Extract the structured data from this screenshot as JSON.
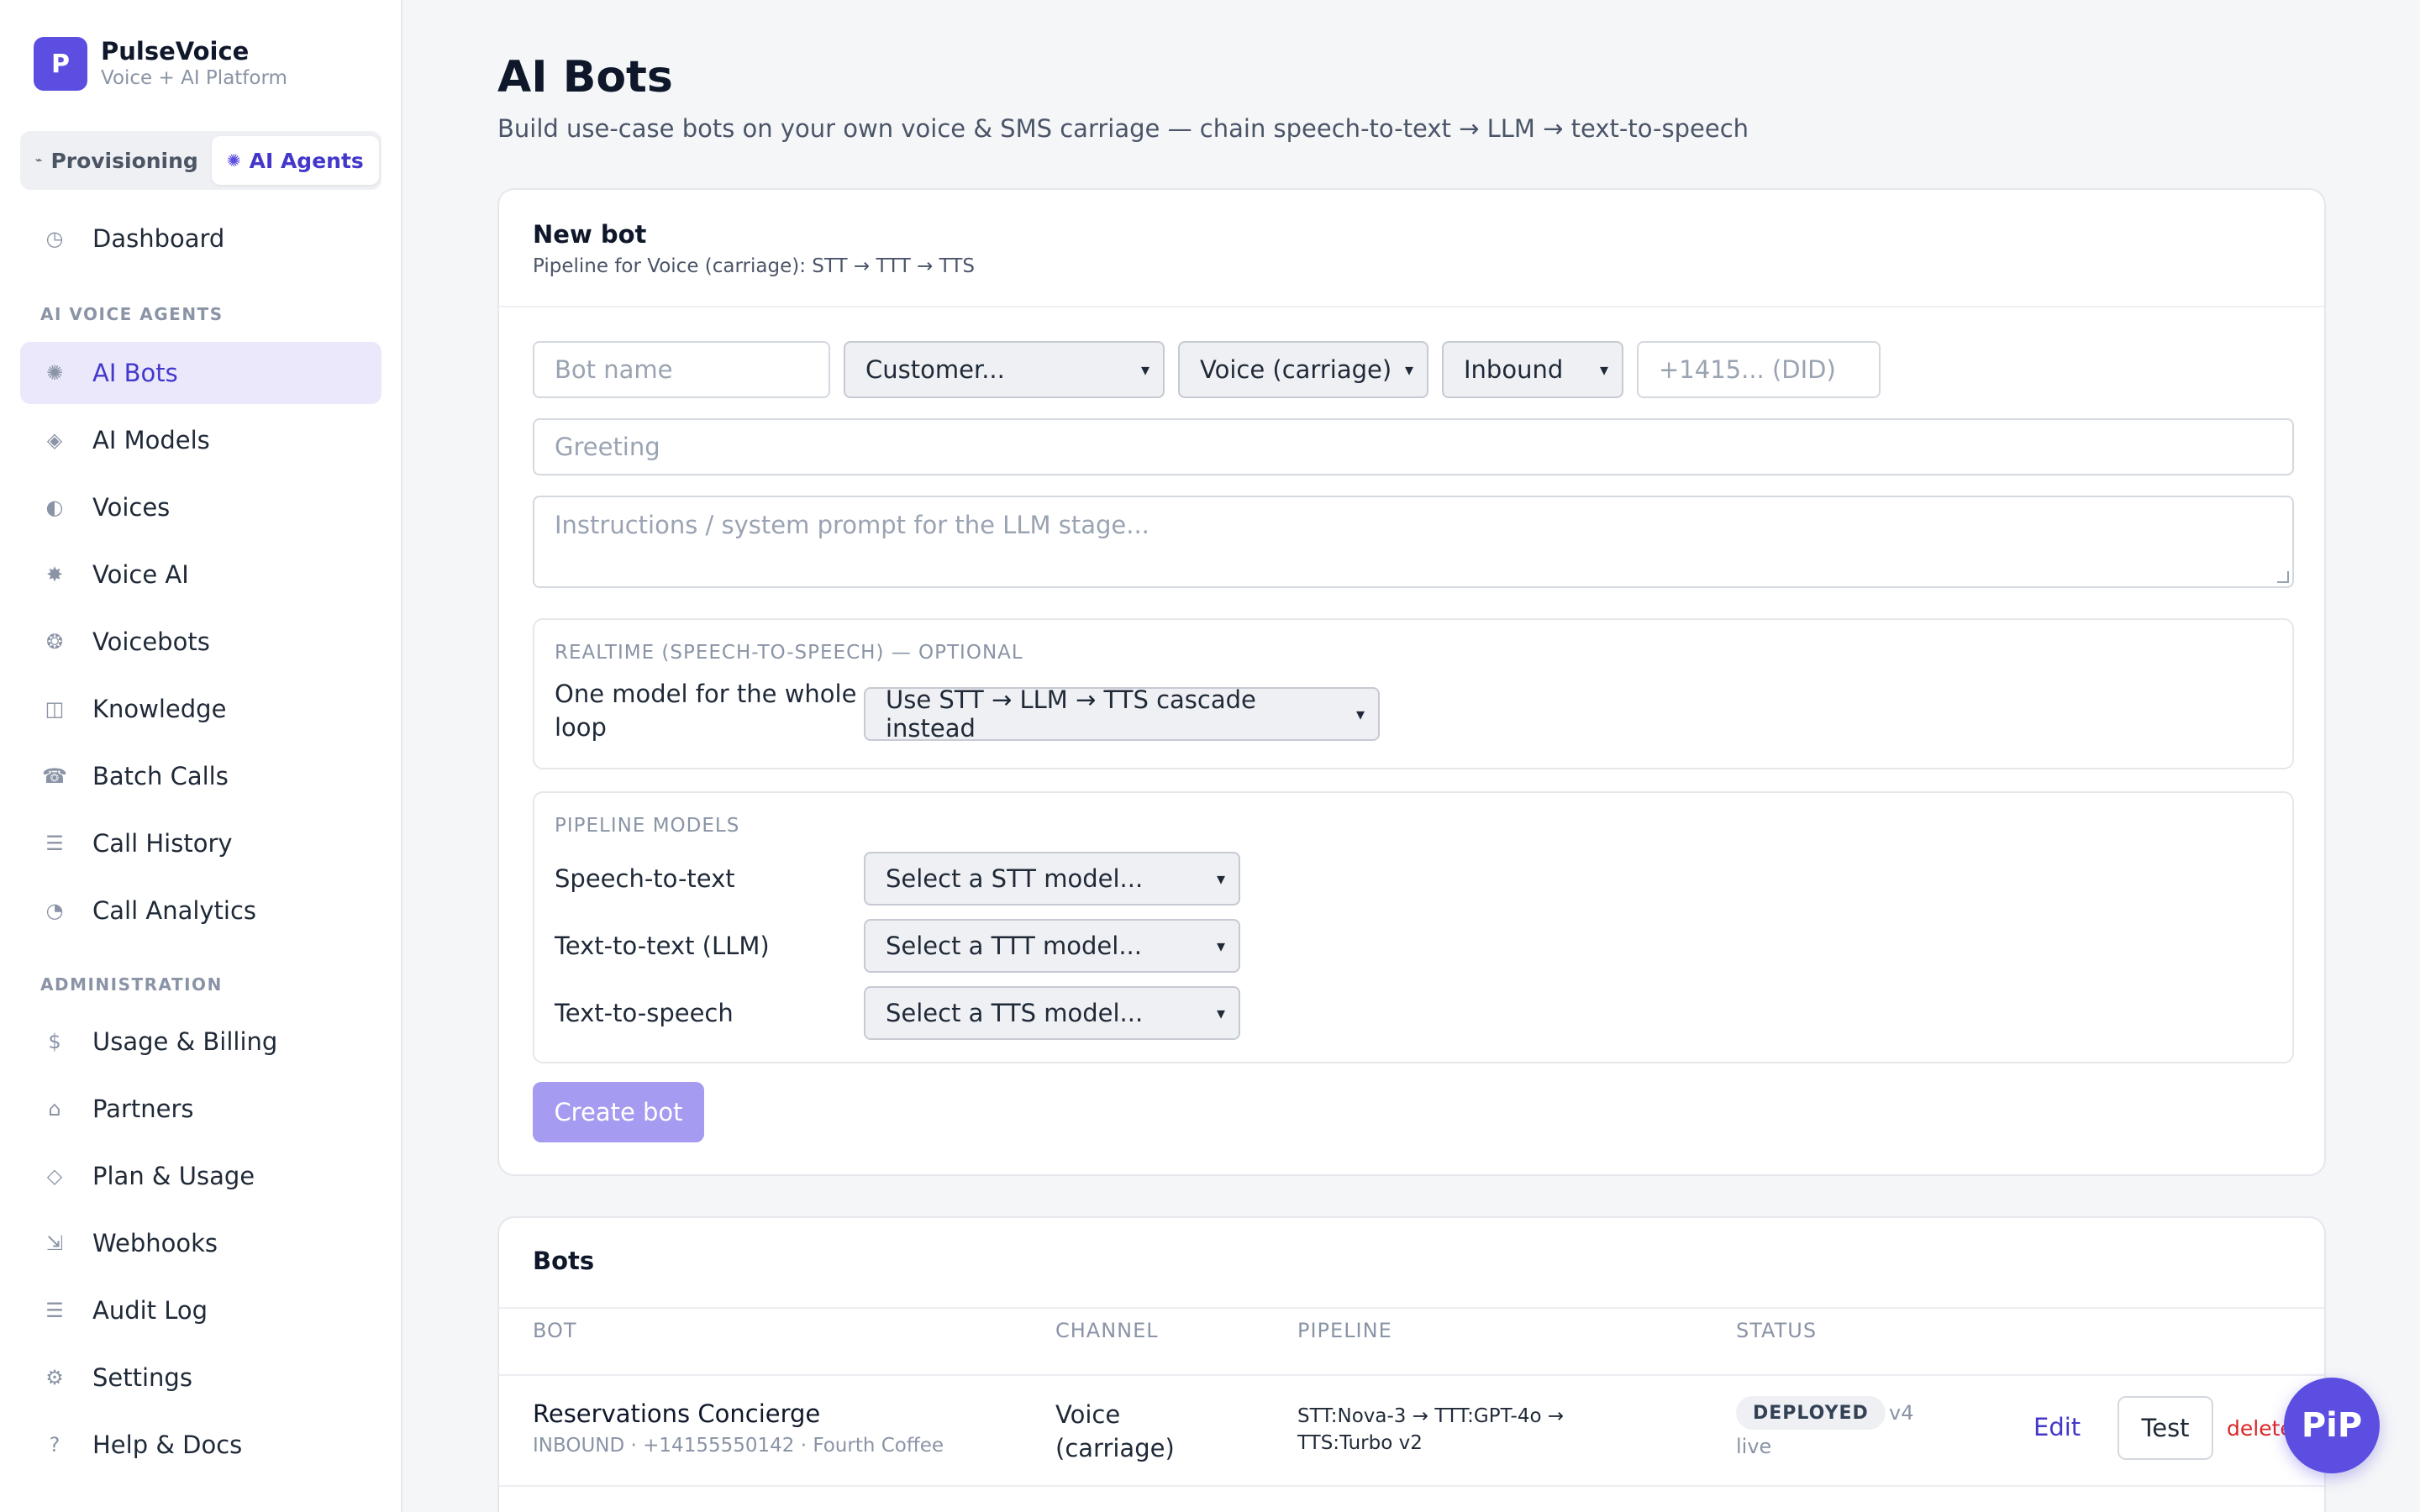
{
  "brand": {
    "logo_letter": "P",
    "name": "PulseVoice",
    "subtitle": "Voice + AI Platform"
  },
  "switcher": {
    "items": [
      {
        "label": "Provisioning",
        "icon": "small-arrow-icon",
        "active": false
      },
      {
        "label": "AI Agents",
        "icon": "sparkle-icon",
        "active": true
      }
    ]
  },
  "sidebar": {
    "top_items": [
      {
        "label": "Dashboard",
        "icon": "clock-icon",
        "glyph": "◷"
      }
    ],
    "sections": [
      {
        "heading": "AI VOICE AGENTS",
        "items": [
          {
            "label": "AI Bots",
            "icon": "sparkle-icon",
            "glyph": "✺",
            "active": true
          },
          {
            "label": "AI Models",
            "icon": "diamond-icon",
            "glyph": "◈"
          },
          {
            "label": "Voices",
            "icon": "half-circle-icon",
            "glyph": "◐"
          },
          {
            "label": "Voice AI",
            "icon": "star-icon",
            "glyph": "✸"
          },
          {
            "label": "Voicebots",
            "icon": "bot-icon",
            "glyph": "❂"
          },
          {
            "label": "Knowledge",
            "icon": "book-icon",
            "glyph": "◫"
          },
          {
            "label": "Batch Calls",
            "icon": "phone-icon",
            "glyph": "☎"
          },
          {
            "label": "Call History",
            "icon": "list-icon",
            "glyph": "☰"
          },
          {
            "label": "Call Analytics",
            "icon": "pie-icon",
            "glyph": "◔"
          }
        ]
      },
      {
        "heading": "ADMINISTRATION",
        "items": [
          {
            "label": "Usage & Billing",
            "icon": "dollar-icon",
            "glyph": "$"
          },
          {
            "label": "Partners",
            "icon": "home-icon",
            "glyph": "⌂"
          },
          {
            "label": "Plan & Usage",
            "icon": "diamond-outline-icon",
            "glyph": "◇"
          },
          {
            "label": "Webhooks",
            "icon": "arrow-corner-icon",
            "glyph": "⇲"
          },
          {
            "label": "Audit Log",
            "icon": "list-icon",
            "glyph": "☰"
          },
          {
            "label": "Settings",
            "icon": "gear-icon",
            "glyph": "⚙"
          },
          {
            "label": "Help & Docs",
            "icon": "question-icon",
            "glyph": "?"
          }
        ]
      }
    ]
  },
  "page": {
    "title": "AI Bots",
    "subtitle": "Build use-case bots on your own voice & SMS carriage — chain speech-to-text → LLM → text-to-speech"
  },
  "new_bot": {
    "title": "New bot",
    "subtitle": "Pipeline for Voice (carriage): STT → TTT → TTS",
    "bot_name_placeholder": "Bot name",
    "customer_select": "Customer...",
    "channel_select": "Voice (carriage)",
    "direction_select": "Inbound",
    "did_placeholder": "+1415... (DID)",
    "greeting_placeholder": "Greeting",
    "instructions_placeholder": "Instructions / system prompt for the LLM stage...",
    "realtime": {
      "title": "REALTIME (SPEECH-TO-SPEECH) — OPTIONAL",
      "label": "One model for the whole loop",
      "select": "Use STT → LLM → TTS cascade instead"
    },
    "pipeline": {
      "title": "PIPELINE MODELS",
      "rows": [
        {
          "label": "Speech-to-text",
          "select": "Select a STT model..."
        },
        {
          "label": "Text-to-text (LLM)",
          "select": "Select a TTT model..."
        },
        {
          "label": "Text-to-speech",
          "select": "Select a TTS model..."
        }
      ]
    },
    "create_label": "Create bot"
  },
  "bots": {
    "title": "Bots",
    "columns": [
      "BOT",
      "CHANNEL",
      "PIPELINE",
      "STATUS"
    ],
    "rows": [
      {
        "name": "Reservations Concierge",
        "meta": "INBOUND · +14155550142 · Fourth Coffee",
        "channel": "Voice (carriage)",
        "pipeline": "STT:Nova-3 → TTT:GPT-4o → TTS:Turbo v2",
        "status": "DEPLOYED",
        "version": "v4",
        "live": "live",
        "edit": "Edit",
        "test": "Test",
        "delete": "delete"
      }
    ]
  },
  "pip_label": "PiP",
  "colors": {
    "accent": "#5b4ee0",
    "accent_text": "#4338ca",
    "danger": "#dc2626",
    "active_bg": "#ebe8fc"
  }
}
